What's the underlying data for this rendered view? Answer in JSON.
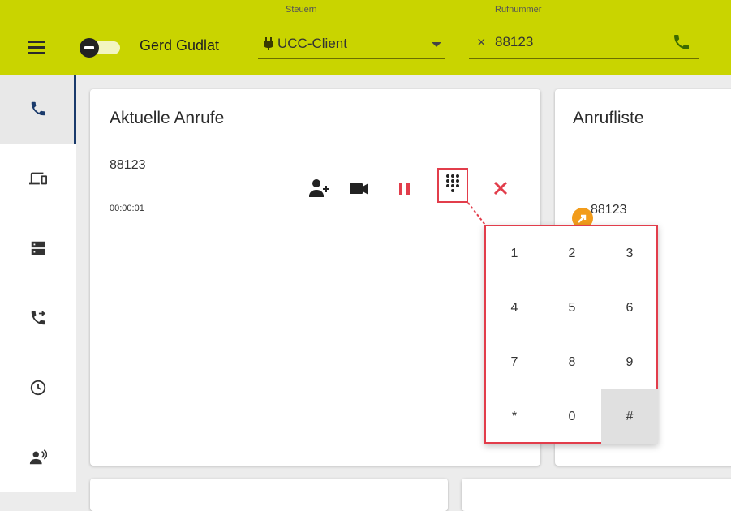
{
  "header": {
    "user_name": "Gerd Gudlat",
    "control_label": "Steuern",
    "control_value": "UCC-Client",
    "number_label": "Rufnummer",
    "number_value": "88123",
    "clear_symbol": "×"
  },
  "sidebar": {
    "items": [
      {
        "icon": "phone-icon",
        "active": true
      },
      {
        "icon": "devices-icon",
        "active": false
      },
      {
        "icon": "server-icon",
        "active": false
      },
      {
        "icon": "call-forward-icon",
        "active": false
      },
      {
        "icon": "clock-icon",
        "active": false
      },
      {
        "icon": "voicemail-icon",
        "active": false
      }
    ]
  },
  "current_calls": {
    "title": "Aktuelle Anrufe",
    "call": {
      "number": "88123",
      "duration": "00:00:01",
      "actions": [
        "add-participant-icon",
        "video-icon",
        "hold-icon",
        "dialpad-icon",
        "hangup-icon"
      ]
    }
  },
  "keypad": {
    "keys": [
      "1",
      "2",
      "3",
      "4",
      "5",
      "6",
      "7",
      "8",
      "9",
      "*",
      "0",
      "#"
    ],
    "pressed_key": "#"
  },
  "call_list": {
    "title": "Anrufliste",
    "items": [
      {
        "number": "88123",
        "icon": "outgoing-call-icon"
      }
    ]
  },
  "colors": {
    "header_bg": "#c9d400",
    "accent_red": "#e23d4b",
    "active_indicator": "#1a3a6b",
    "call_badge": "#f29c1b"
  }
}
